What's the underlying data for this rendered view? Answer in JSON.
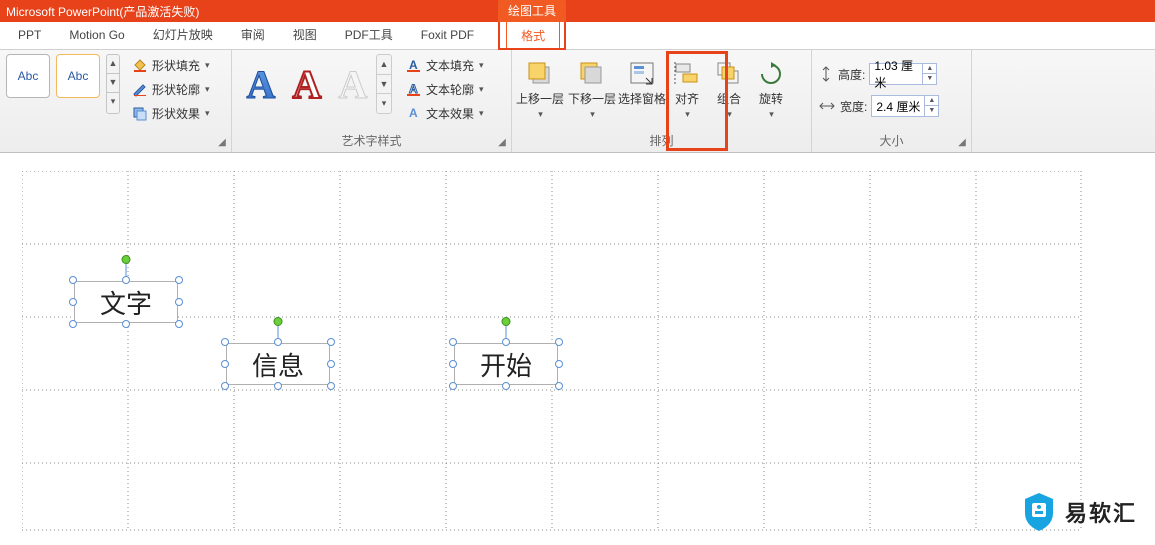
{
  "titlebar": {
    "app": "Microsoft PowerPoint(产品激活失败)",
    "context_tab": "绘图工具"
  },
  "tabs": {
    "ppt": "PPT",
    "motion": "Motion Go",
    "slideshow": "幻灯片放映",
    "review": "审阅",
    "view": "视图",
    "pdf": "PDF工具",
    "foxit": "Foxit PDF",
    "format": "格式"
  },
  "shapes_group": {
    "sample": "Abc",
    "fill": "形状填充",
    "outline": "形状轮廓",
    "effects": "形状效果"
  },
  "wordart_group": {
    "label": "艺术字样式",
    "text_fill": "文本填充",
    "text_outline": "文本轮廓",
    "text_effects": "文本效果"
  },
  "arrange_group": {
    "label": "排列",
    "bring_forward": "上移一层",
    "send_backward": "下移一层",
    "selection_pane": "选择窗格",
    "align": "对齐",
    "group": "组合",
    "rotate": "旋转"
  },
  "size_group": {
    "label": "大小",
    "height_label": "高度:",
    "height_val": "1.03 厘米",
    "width_label": "宽度:",
    "width_val": "2.4 厘米"
  },
  "slide": {
    "box1": "文字",
    "box2": "信息",
    "box3": "开始"
  },
  "watermark": {
    "text": "易软汇"
  }
}
